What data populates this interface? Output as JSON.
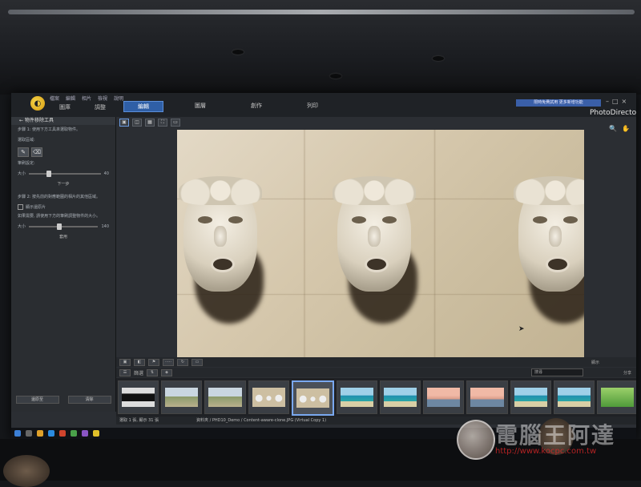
{
  "app": {
    "brand": "PhotoDirector",
    "menus": [
      "檔案",
      "編輯",
      "相片",
      "檢視",
      "說明"
    ],
    "library_tabs": [
      "圖庫",
      "調整"
    ],
    "main_tabs": [
      {
        "label": "編輯",
        "active": true
      },
      {
        "label": "圖層",
        "active": false
      },
      {
        "label": "創作",
        "active": false
      },
      {
        "label": "列印",
        "active": false
      }
    ],
    "notice": "限時免費試用 更多新增功能"
  },
  "left_panel": {
    "title": "物件移除工具",
    "step1": "步驟 1: 使用下方工具來選取物件。",
    "select_area": "選取區域:",
    "brush_settings": "筆刷設定:",
    "size_label": "大小",
    "size_value": "40",
    "next_button": "下一步",
    "step2": "步驟 2: 按先前的對應範圍的相片的其他區域。",
    "show_source": "顯示還原片",
    "step3": "如果需要, 請使用下方的筆刷調整物件的大小。",
    "size2_label": "大小",
    "size2_value": "140",
    "apply_button": "套用",
    "bottom_buttons": [
      "還原至",
      "清除"
    ]
  },
  "toolbar": {
    "filter_label": "篩選",
    "search_placeholder": "搜尋",
    "right_labels": [
      "顯示",
      "分享"
    ]
  },
  "filmstrip": {
    "thumbs": [
      {
        "kind": "dark"
      },
      {
        "kind": "beach"
      },
      {
        "kind": "beach"
      },
      {
        "kind": "faces"
      },
      {
        "kind": "faces",
        "selected": true
      },
      {
        "kind": "sea"
      },
      {
        "kind": "sea"
      },
      {
        "kind": "sunset"
      },
      {
        "kind": "sunset"
      },
      {
        "kind": "sea"
      },
      {
        "kind": "sea"
      },
      {
        "kind": "green"
      }
    ]
  },
  "status": {
    "count": "選取 1 張, 顯示 31 張",
    "path": "資料夾 / PHD10_Demo / Content-aware-clone.JPG (Virtual Copy 1)"
  },
  "watermark": {
    "title": "電腦王阿達",
    "url": "http://www.kocpc.com.tw"
  },
  "colors": {
    "accent": "#2f5fa6",
    "selection": "#7aa8ef"
  }
}
